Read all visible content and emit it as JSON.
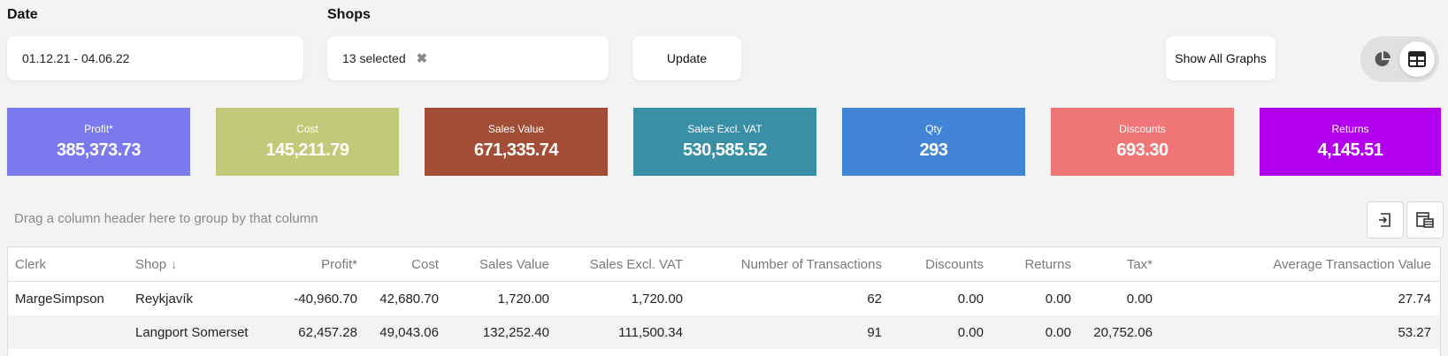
{
  "filters": {
    "date_label": "Date",
    "date_value": "01.12.21 - 04.06.22",
    "shops_label": "Shops",
    "shops_value": "13 selected",
    "shops_clear_glyph": "✖",
    "update_label": "Update",
    "show_all_graphs_label": "Show All Graphs"
  },
  "view_toggle": {
    "options": [
      {
        "name": "pie-chart-icon",
        "active": false
      },
      {
        "name": "table-icon",
        "active": true
      }
    ]
  },
  "kpis": [
    {
      "title": "Profit*",
      "value": "385,373.73",
      "color": "#7b79ee"
    },
    {
      "title": "Cost",
      "value": "145,211.79",
      "color": "#c2c978"
    },
    {
      "title": "Sales Value",
      "value": "671,335.74",
      "color": "#a24d36"
    },
    {
      "title": "Sales Excl. VAT",
      "value": "530,585.52",
      "color": "#398fa5"
    },
    {
      "title": "Qty",
      "value": "293",
      "color": "#4285d6"
    },
    {
      "title": "Discounts",
      "value": "693.30",
      "color": "#ef7576"
    },
    {
      "title": "Returns",
      "value": "4,145.51",
      "color": "#b200ef"
    }
  ],
  "grid": {
    "group_hint": "Drag a column header here to group by that column",
    "toolbar_icons": [
      "export-icon",
      "column-chooser-icon"
    ],
    "columns": [
      "Clerk",
      "Shop",
      "Profit*",
      "Cost",
      "Sales Value",
      "Sales Excl. VAT",
      "Number of Transactions",
      "Discounts",
      "Returns",
      "Tax*",
      "Average Transaction Value"
    ],
    "sort_glyph": "↓",
    "rows": [
      [
        "MargeSimpson",
        "Reykjavík",
        "-40,960.70",
        "42,680.70",
        "1,720.00",
        "1,720.00",
        "62",
        "0.00",
        "0.00",
        "0.00",
        "27.74"
      ],
      [
        "",
        "Langport Somerset",
        "62,457.28",
        "49,043.06",
        "132,252.40",
        "111,500.34",
        "91",
        "0.00",
        "0.00",
        "20,752.06",
        "53.27"
      ]
    ]
  }
}
